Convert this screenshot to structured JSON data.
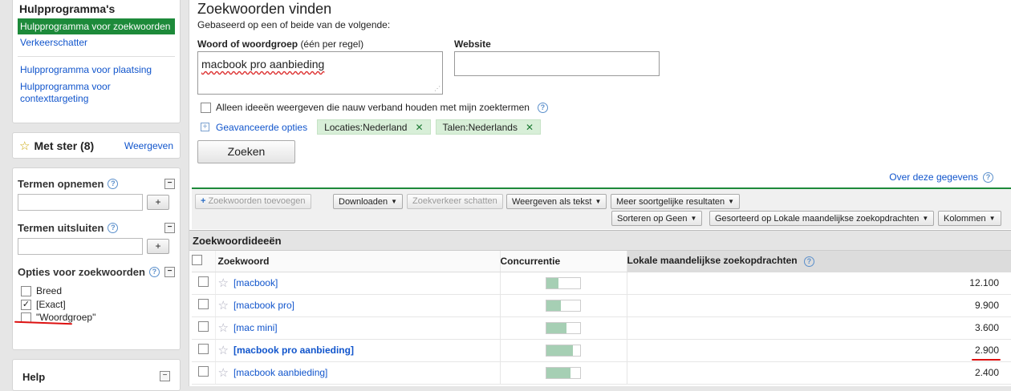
{
  "sidebar": {
    "tools_title": "Hulpprogramma's",
    "tools": [
      {
        "label": "Hulpprogramma voor zoekwoorden",
        "selected": true
      },
      {
        "label": "Verkeerschatter"
      },
      {
        "label": "Hulpprogramma voor plaatsing"
      },
      {
        "label": "Hulpprogramma voor contexttargeting"
      }
    ],
    "starred": {
      "title": "Met ster (8)",
      "show": "Weergeven"
    },
    "include": {
      "title": "Termen opnemen",
      "button": "+",
      "value": ""
    },
    "exclude": {
      "title": "Termen uitsluiten",
      "button": "+",
      "value": ""
    },
    "match_options": {
      "title": "Opties voor zoekwoorden",
      "options": [
        {
          "label": "Breed",
          "checked": false
        },
        {
          "label": "[Exact]",
          "checked": true
        },
        {
          "label": "\"Woordgroep\"",
          "checked": false
        }
      ]
    },
    "help": {
      "title": "Help"
    }
  },
  "main": {
    "title": "Zoekwoorden vinden",
    "subtitle": "Gebaseerd op een of beide van de volgende:",
    "keyword_label": "Woord of woordgroep",
    "keyword_label_note": "(één per regel)",
    "keyword_value": "macbook pro aanbieding",
    "website_label": "Website",
    "website_value": "",
    "closely_related": "Alleen ideeën weergeven die nauw verband houden met mijn zoektermen",
    "advanced": "Geavanceerde opties",
    "chips": [
      "Locaties:Nederland",
      "Talen:Nederlands"
    ],
    "search_button": "Zoeken",
    "about": "Over deze gegevens"
  },
  "toolbar": {
    "add_keywords": "Zoekwoorden toevoegen",
    "download": "Downloaden",
    "estimate": "Zoekverkeer schatten",
    "view_as_text": "Weergeven als tekst",
    "more_like": "Meer soortgelijke resultaten",
    "sort": "Sorteren op Geen",
    "sorted_by": "Gesorteerd op Lokale maandelijkse zoekopdrachten",
    "columns": "Kolommen"
  },
  "results": {
    "section_title": "Zoekwoordideeën",
    "columns": {
      "keyword": "Zoekwoord",
      "competition": "Concurrentie",
      "volume": "Lokale maandelijkse zoekopdrachten"
    },
    "rows": [
      {
        "keyword": "[macbook]",
        "competition": 0.35,
        "volume": "12.100",
        "bold": false
      },
      {
        "keyword": "[macbook pro]",
        "competition": 0.42,
        "volume": "9.900",
        "bold": false
      },
      {
        "keyword": "[mac mini]",
        "competition": 0.6,
        "volume": "3.600",
        "bold": false
      },
      {
        "keyword": "[macbook pro aanbieding]",
        "competition": 0.78,
        "volume": "2.900",
        "bold": true
      },
      {
        "keyword": "[macbook aanbieding]",
        "competition": 0.72,
        "volume": "2.400",
        "bold": false
      }
    ]
  },
  "colors": {
    "accent": "#1d8a3a",
    "link": "#1155cc",
    "competition_bar": "#a6cfb4",
    "annotation": "#dd1111"
  }
}
